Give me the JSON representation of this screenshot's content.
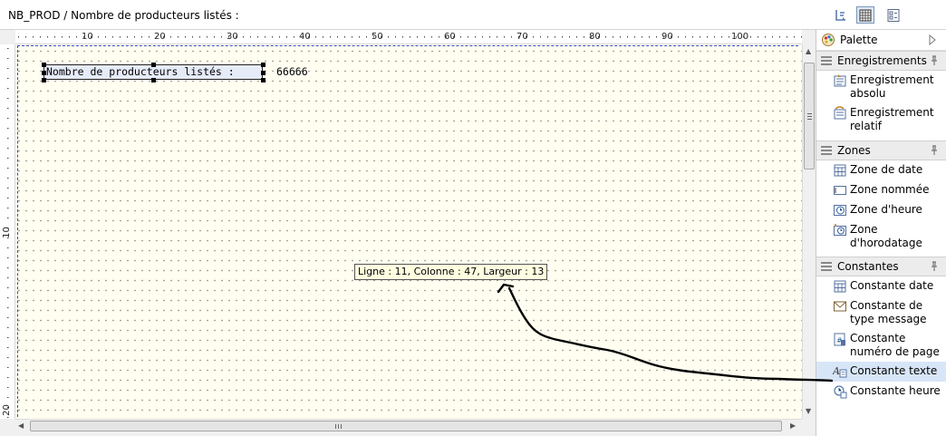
{
  "window": {
    "title": "NB_PROD / Nombre de producteurs listés :"
  },
  "toolbar": {
    "buttons": [
      "layout-icon",
      "grid-icon",
      "properties-icon"
    ]
  },
  "ruler": {
    "top": [
      "10",
      "20",
      "30",
      "40",
      "50",
      "60",
      "70",
      "80",
      "90",
      "100"
    ],
    "left": [
      "10",
      "20"
    ]
  },
  "canvas": {
    "field_label": "Nombre de producteurs listés :",
    "field_value": "66666",
    "tooltip": "Ligne : 11, Colonne : 47, Largeur : 13"
  },
  "palette": {
    "title": "Palette",
    "drawers": [
      {
        "label": "Enregistrements",
        "items": [
          {
            "label": "Enregistrement absolu",
            "icon": "record-absolute-icon"
          },
          {
            "label": "Enregistrement relatif",
            "icon": "record-relative-icon"
          }
        ]
      },
      {
        "label": "Zones",
        "items": [
          {
            "label": "Zone de date",
            "icon": "date-zone-icon"
          },
          {
            "label": "Zone nommée",
            "icon": "named-zone-icon"
          },
          {
            "label": "Zone d'heure",
            "icon": "time-zone-icon"
          },
          {
            "label": "Zone d'horodatage",
            "icon": "timestamp-zone-icon"
          }
        ]
      },
      {
        "label": "Constantes",
        "items": [
          {
            "label": "Constante date",
            "icon": "constant-date-icon"
          },
          {
            "label": "Constante de type message",
            "icon": "constant-message-icon"
          },
          {
            "label": "Constante numéro de page",
            "icon": "constant-page-number-icon"
          },
          {
            "label": "Constante texte",
            "icon": "constant-text-icon",
            "selected": true
          },
          {
            "label": "Constante heure",
            "icon": "constant-time-icon"
          }
        ]
      }
    ]
  }
}
